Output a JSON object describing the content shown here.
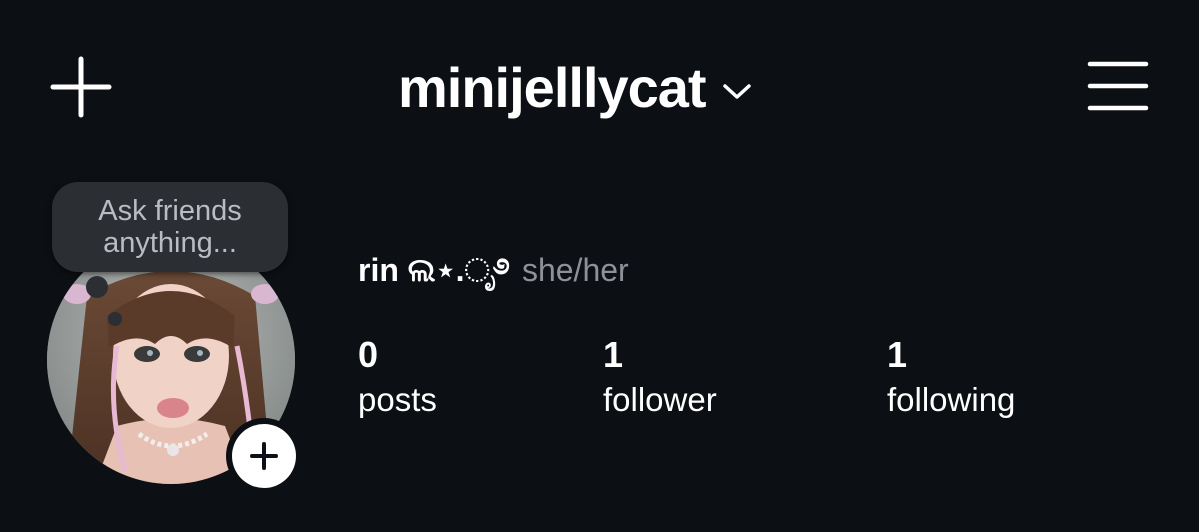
{
  "header": {
    "username": "minijelllycat",
    "new_post_icon": "plus-icon",
    "account_switcher_icon": "chevron-down-icon",
    "menu_icon": "hamburger-menu-icon"
  },
  "profile": {
    "note_prompt": "Ask friends anything...",
    "display_name": "rin ଲ⋆.ೃ࿔",
    "pronouns": "she/her",
    "stats": [
      {
        "value": "0",
        "label": "posts"
      },
      {
        "value": "1",
        "label": "follower"
      },
      {
        "value": "1",
        "label": "following"
      }
    ],
    "add_story_icon": "plus-icon"
  },
  "colors": {
    "background": "#0c0f14",
    "text_primary": "#ffffff",
    "text_secondary": "#8e9298",
    "note_bubble": "#2b2e33"
  }
}
